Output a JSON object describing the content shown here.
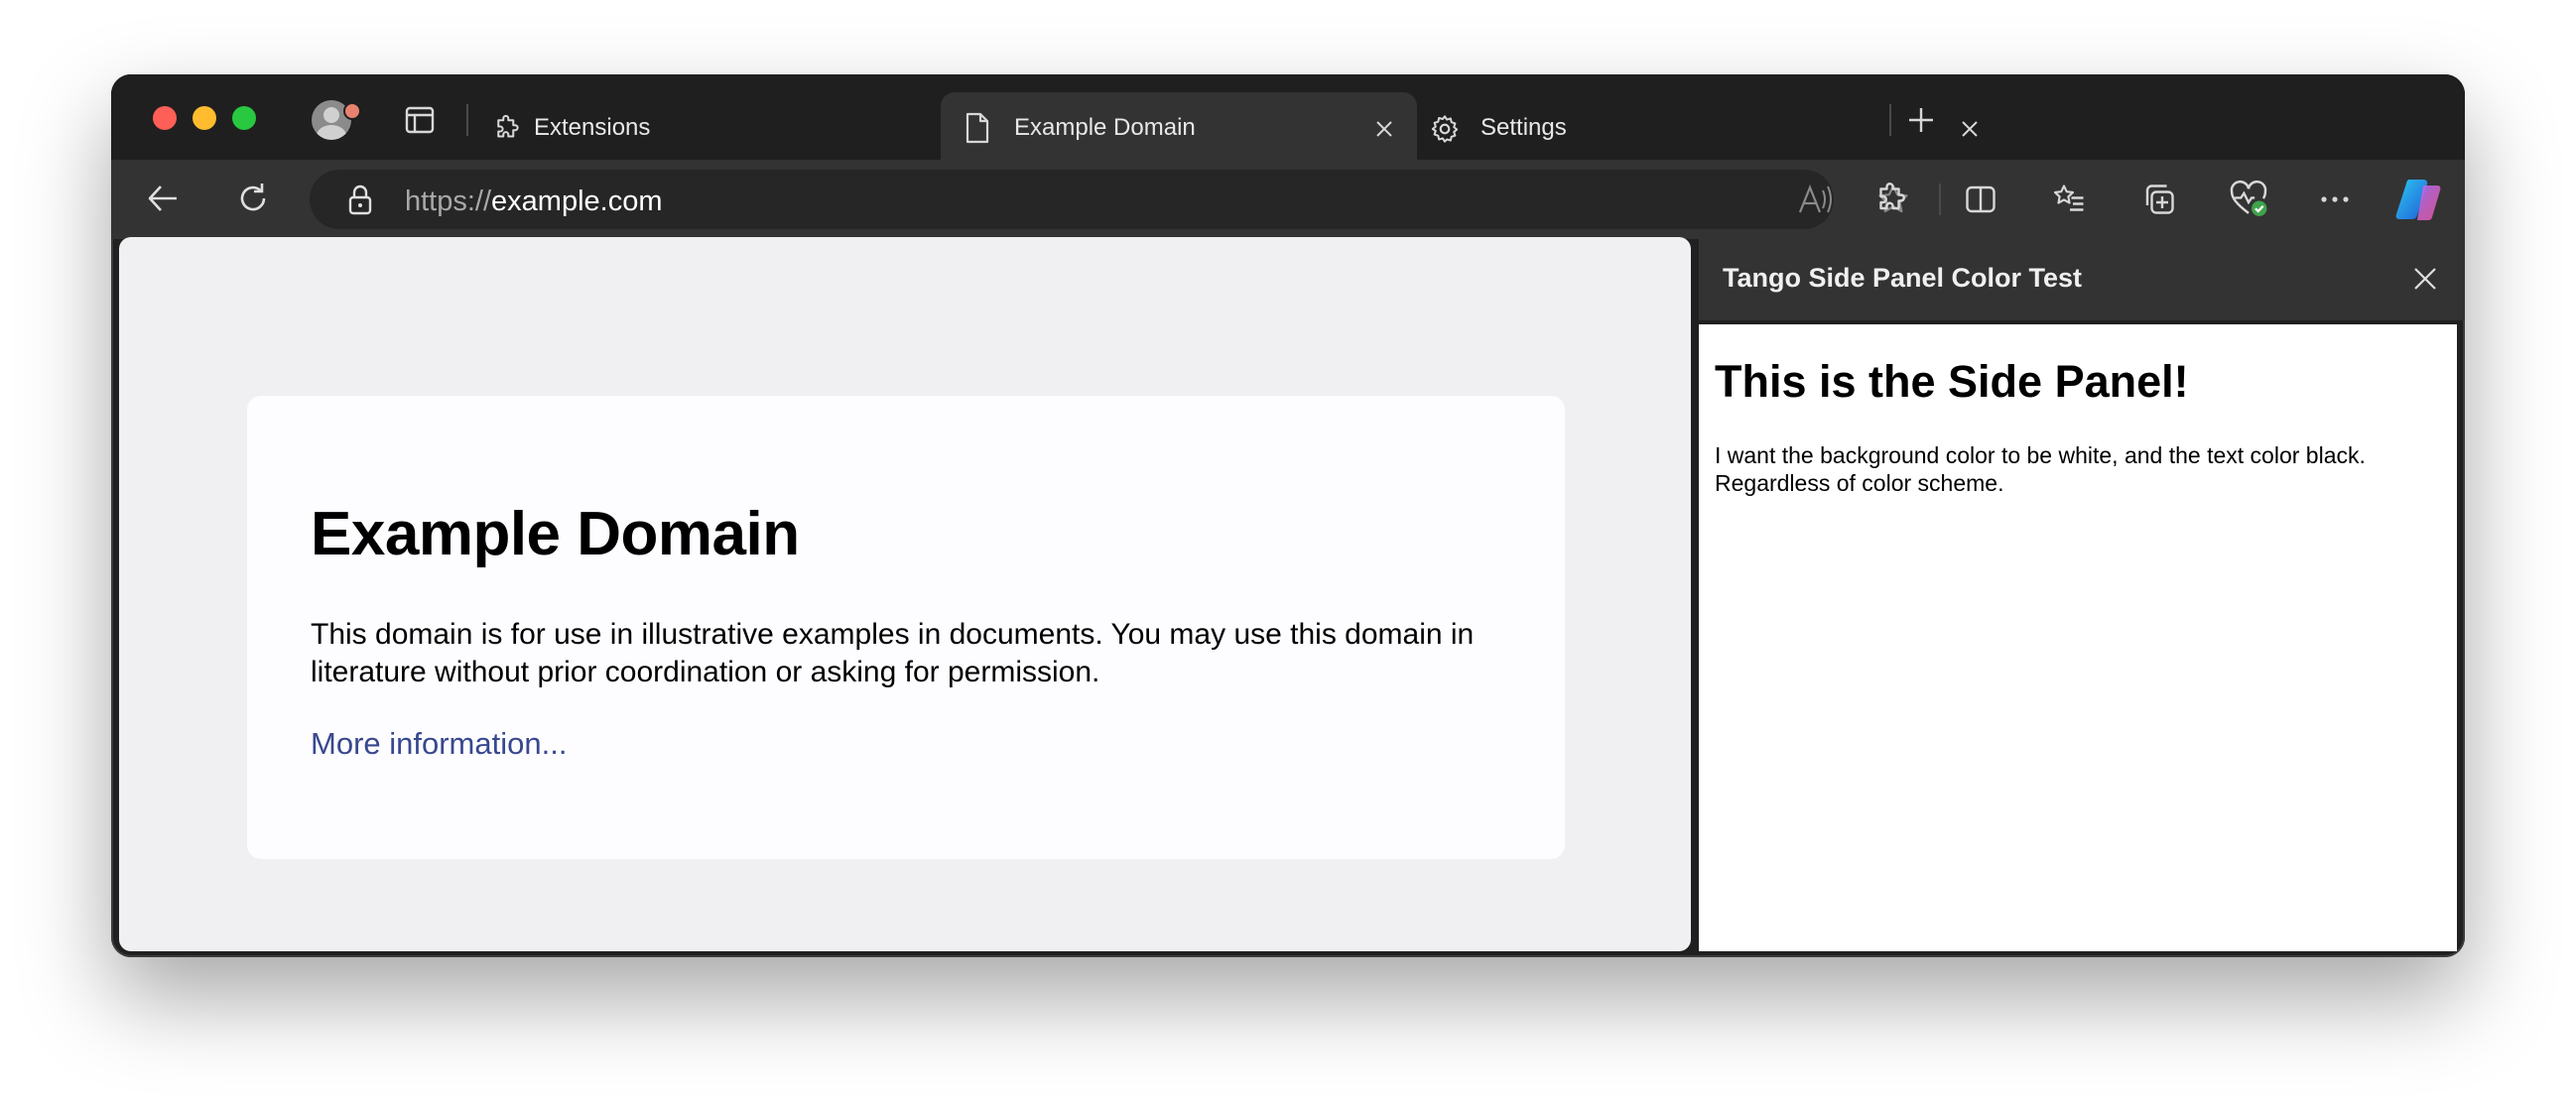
{
  "window": {
    "tabs": [
      {
        "label": "Extensions",
        "icon": "puzzle-icon",
        "active": false
      },
      {
        "label": "Example Domain",
        "icon": "page-icon",
        "active": true
      },
      {
        "label": "Settings",
        "icon": "gear-icon",
        "active": false
      }
    ]
  },
  "toolbar": {
    "url_scheme": "https://",
    "url_host": "example.com"
  },
  "page": {
    "heading": "Example Domain",
    "body": "This domain is for use in illustrative examples in documents. You may use this domain in literature without prior coordination or asking for permission.",
    "link": "More information..."
  },
  "side_panel": {
    "title": "Tango Side Panel Color Test",
    "heading": "This is the Side Panel!",
    "body": "I want the background color to be white, and the text color black. Regardless of color scheme."
  },
  "colors": {
    "frame": "#1f1f1f",
    "toolbar": "#333333",
    "page_bg": "#f0f0f2",
    "card_bg": "#fdfdff",
    "link": "#38488f",
    "copilot": "#3a8ee6"
  }
}
